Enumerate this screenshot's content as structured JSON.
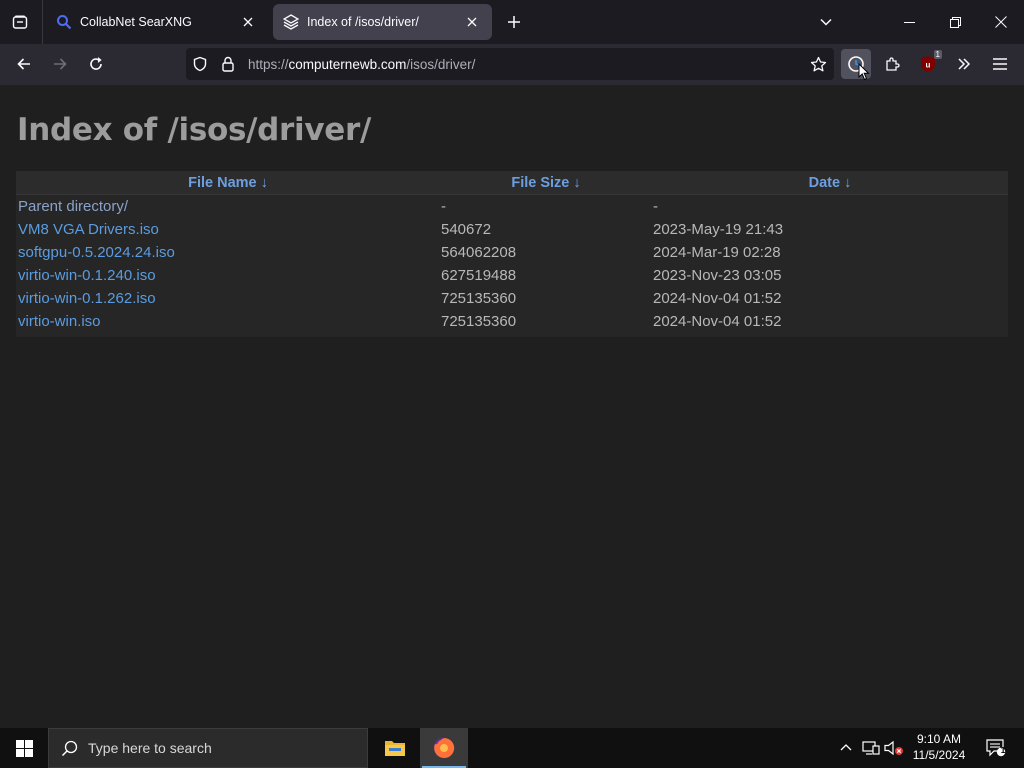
{
  "browser": {
    "tabs": [
      {
        "title": "CollabNet SearXNG",
        "favicon": "search-icon",
        "active": false
      },
      {
        "title": "Index of /isos/driver/",
        "favicon": "stack-icon",
        "active": true
      }
    ],
    "url_prefix": "https://",
    "url_host": "computernewb.com",
    "url_path": "/isos/driver/",
    "extension_badge": "1"
  },
  "page": {
    "heading": "Index of /isos/driver/",
    "columns": {
      "name": "File Name  ↓",
      "size": "File Size  ↓",
      "date": "Date  ↓"
    },
    "rows": [
      {
        "name": "Parent directory/",
        "size": "-",
        "date": "-"
      },
      {
        "name": "VM8 VGA Drivers.iso",
        "size": "540672",
        "date": "2023-May-19 21:43"
      },
      {
        "name": "softgpu-0.5.2024.24.iso",
        "size": "564062208",
        "date": "2024-Mar-19 02:28"
      },
      {
        "name": "virtio-win-0.1.240.iso",
        "size": "627519488",
        "date": "2023-Nov-23 03:05"
      },
      {
        "name": "virtio-win-0.1.262.iso",
        "size": "725135360",
        "date": "2024-Nov-04 01:52"
      },
      {
        "name": "virtio-win.iso",
        "size": "725135360",
        "date": "2024-Nov-04 01:52"
      }
    ]
  },
  "taskbar": {
    "search_placeholder": "Type here to search",
    "time": "9:10 AM",
    "date": "11/5/2024",
    "notification_count": "1"
  },
  "colors": {
    "link": "#5b9ce0",
    "header_link": "#6d9fe0",
    "heading": "#9c9c9c",
    "page_bg": "#1f1f1f"
  }
}
